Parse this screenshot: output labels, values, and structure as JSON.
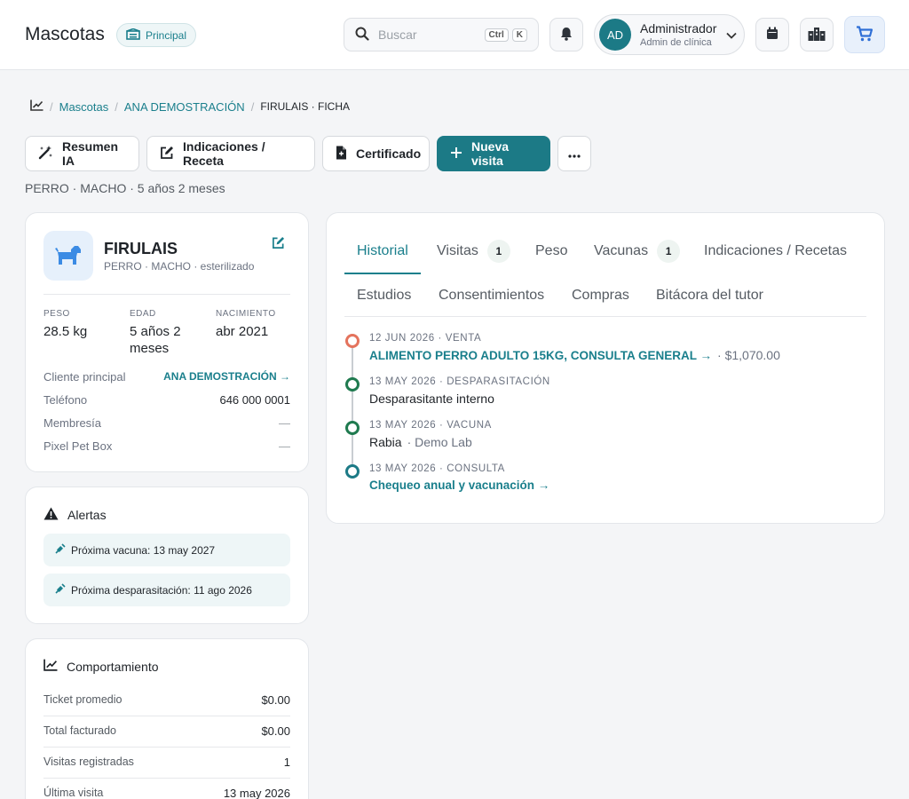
{
  "header": {
    "app_title": "Mascotas",
    "branch_badge": "Principal",
    "search_placeholder": "Buscar",
    "kbd_ctrl": "Ctrl",
    "kbd_k": "K",
    "user_initials": "AD",
    "user_name": "Administrador",
    "user_role": "Admin de clínica"
  },
  "breadcrumb": {
    "items": [
      "Mascotas",
      "ANA DEMOSTRACIÓN"
    ],
    "current": "FIRULAIS · FICHA"
  },
  "actions": {
    "summary_ai": "Resumen IA",
    "prescription": "Indicaciones / Receta",
    "certificate": "Certificado",
    "new_visit": "Nueva visita"
  },
  "subtitle": "PERRO · MACHO · 5 años 2 meses",
  "pet": {
    "name": "FIRULAIS",
    "meta": "PERRO · MACHO · esterilizado",
    "weight_label": "PESO",
    "weight": "28.5 kg",
    "age_label": "EDAD",
    "age": "5 años 2 meses",
    "birth_label": "NACIMIENTO",
    "birth": "abr 2021",
    "details": [
      {
        "k": "Cliente principal",
        "v": "ANA DEMOSTRACIÓN →"
      },
      {
        "k": "Teléfono",
        "v": "646 000 0001"
      },
      {
        "k": "Membresía",
        "v": "—"
      },
      {
        "k": "Pixel Pet Box",
        "v": "—"
      }
    ]
  },
  "alerts": {
    "title": "Alertas",
    "items": [
      "Próxima vacuna: 13 may 2027",
      "Próxima desparasitación: 11 ago 2026"
    ]
  },
  "behavior": {
    "title": "Comportamiento",
    "rows": [
      {
        "k": "Ticket promedio",
        "v": "$0.00"
      },
      {
        "k": "Total facturado",
        "v": "$0.00"
      },
      {
        "k": "Visitas registradas",
        "v": "1"
      },
      {
        "k": "Última visita",
        "v": "13 may 2026"
      }
    ]
  },
  "tabs": {
    "historial": "Historial",
    "visitas": "Visitas",
    "visitas_count": "1",
    "peso": "Peso",
    "vacunas": "Vacunas",
    "vacunas_count": "1",
    "indicaciones": "Indicaciones / Recetas",
    "estudios": "Estudios",
    "consentimientos": "Consentimientos",
    "compras": "Compras",
    "bitacora": "Bitácora del tutor"
  },
  "timeline": [
    {
      "meta": "12 JUN 2026 · VENTA",
      "link": "ALIMENTO PERRO ADULTO 15KG, CONSULTA GENERAL →",
      "extra": "· $1,070.00",
      "color": "#e4735d"
    },
    {
      "meta": "13 MAY 2026 · DESPARASITACIÓN",
      "text": "Desparasitante interno",
      "color": "#1f7a4f"
    },
    {
      "meta": "13 MAY 2026 · VACUNA",
      "text": "Rabia",
      "extra": "· Demo Lab",
      "color": "#1f7a4f"
    },
    {
      "meta": "13 MAY 2026 · CONSULTA",
      "link": "Chequeo anual y vacunación →",
      "color": "#1c7a86"
    }
  ],
  "colors": {
    "accent": "#1c7a86",
    "link": "#1a7f8c"
  }
}
